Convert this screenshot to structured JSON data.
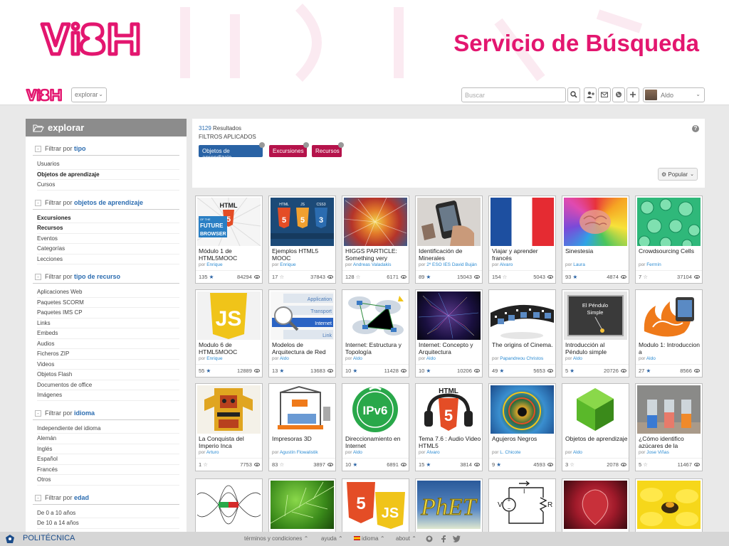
{
  "slide": {
    "title": "Servicio de Búsqueda"
  },
  "topbar": {
    "explorar_label": "explorar",
    "search_placeholder": "Buscar",
    "user_name": "Aldo"
  },
  "sidebar": {
    "header": "explorar",
    "filter_prefix": "Filtrar por",
    "groups": [
      {
        "title": "tipo",
        "items": [
          "Usuarios",
          "Objetos de aprendizaje",
          "Cursos"
        ],
        "active": 1
      },
      {
        "title": "objetos de aprendizaje",
        "items": [
          "Excursiones",
          "Recursos",
          "Eventos",
          "Categorías",
          "Lecciones"
        ],
        "active": [
          0,
          1
        ]
      },
      {
        "title": "tipo de recurso",
        "items": [
          "Aplicaciones Web",
          "Paquetes SCORM",
          "Paquetes IMS CP",
          "Links",
          "Embeds",
          "Audios",
          "Ficheros ZIP",
          "Videos",
          "Objetos Flash",
          "Documentos de office",
          "Imágenes"
        ]
      },
      {
        "title": "idioma",
        "items": [
          "Independiente del idioma",
          "Alemán",
          "Inglés",
          "Español",
          "Francés",
          "Otros"
        ]
      },
      {
        "title": "edad",
        "items": [
          "De 0 a 10 años",
          "De 10 a 14 años"
        ]
      }
    ]
  },
  "results": {
    "count": "3129",
    "count_label": "Resultados",
    "applied_label": "FILTROS APLICADOS",
    "chips": [
      "Objetos de aprendizaje",
      "Excursiones",
      "Recursos"
    ],
    "sort_label": "Popular",
    "help": "?"
  },
  "cards": [
    {
      "title": "Módulo 1 de HTML5MOOC",
      "author": "Enrique",
      "likes": "135",
      "liked": true,
      "views": "84294"
    },
    {
      "title": "Ejemplos HTML5 MOOC",
      "author": "Enrique",
      "likes": "17",
      "liked": false,
      "views": "37843"
    },
    {
      "title": "HIGGS PARTICLE: Something very",
      "author": "Andreas Valadakis",
      "likes": "128",
      "liked": false,
      "views": "6171"
    },
    {
      "title": "Identificación de Minerales",
      "author": "2º ESO IES David Buján",
      "likes": "89",
      "liked": true,
      "views": "15043"
    },
    {
      "title": "Viajar y aprender francés",
      "author": "Alvaro",
      "likes": "154",
      "liked": false,
      "views": "5043"
    },
    {
      "title": "Sinestesia",
      "author": "Laura",
      "likes": "93",
      "liked": true,
      "views": "4874"
    },
    {
      "title": "Crowdsourcing Cells",
      "author": "Fermín",
      "likes": "7",
      "liked": false,
      "views": "37104"
    },
    {
      "title": "Modulo 6 de HTML5MOOC",
      "author": "Enrique",
      "likes": "55",
      "liked": true,
      "views": "12889"
    },
    {
      "title": "Modelos de Arquitectura de Red",
      "author": "Aldo",
      "likes": "13",
      "liked": true,
      "views": "13683"
    },
    {
      "title": "Internet: Estructura y Topología",
      "author": "Aldo",
      "likes": "10",
      "liked": true,
      "views": "11428"
    },
    {
      "title": "Internet: Concepto y Arquitectura",
      "author": "Aldo",
      "likes": "10",
      "liked": true,
      "views": "10206"
    },
    {
      "title": "The origins of Cinema.",
      "author": "Papandreou Christos",
      "likes": "49",
      "liked": true,
      "views": "5653"
    },
    {
      "title": "Introducción al Péndulo simple",
      "author": "Aldo",
      "likes": "5",
      "liked": true,
      "views": "20726"
    },
    {
      "title": "Modulo 1: Introduccion a",
      "author": "Aldo",
      "likes": "27",
      "liked": true,
      "views": "8566"
    },
    {
      "title": "La Conquista del Imperio Inca",
      "author": "Arturo",
      "likes": "1",
      "liked": false,
      "views": "7753"
    },
    {
      "title": "Impresoras 3D",
      "author": "Agustín Flowalistik",
      "likes": "83",
      "liked": false,
      "views": "3897"
    },
    {
      "title": "Direccionamiento en Internet",
      "author": "Aldo",
      "likes": "10",
      "liked": true,
      "views": "6891"
    },
    {
      "title": "Tema 7.6 : Audio Video HTML5",
      "author": "Álvaro",
      "likes": "15",
      "liked": true,
      "views": "3814"
    },
    {
      "title": "Agujeros Negros",
      "author": "L. Chicote",
      "likes": "9",
      "liked": true,
      "views": "4593"
    },
    {
      "title": "Objetos de aprendizaje",
      "author": "Aldo",
      "likes": "3",
      "liked": false,
      "views": "2078"
    },
    {
      "title": "¿Cómo identifico azúcares de la",
      "author": "Jose Viñas",
      "likes": "5",
      "liked": false,
      "views": "11467"
    }
  ],
  "thumb_text": {
    "html": "HTML",
    "future": "FUTURE",
    "of_the": "OF THE",
    "browser": "BROWSER",
    "css3": "CSS3",
    "js": "JS",
    "application": "Application",
    "transport": "Transport",
    "internet": "Internet",
    "link": "Link",
    "pendulo1": "El Péndulo",
    "pendulo2": "Simple",
    "ipv6": "IPv6",
    "phet": "PhET",
    "v": "V",
    "r": "R",
    "i": "I"
  },
  "footer": {
    "university": "POLITÉCNICA",
    "terms": "términos y condiciones",
    "help": "ayuda",
    "language": "idioma",
    "about": "about"
  },
  "colors": {
    "brand_pink": "#e3166f",
    "chip_blue": "#2a63a5",
    "chip_red": "#b5134b",
    "sidebar_header": "#8c8c8c",
    "app_bg": "#e9e9e9"
  }
}
